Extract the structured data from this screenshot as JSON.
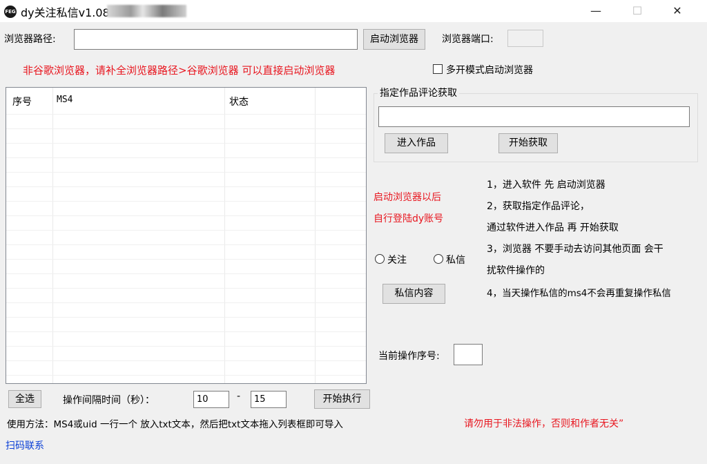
{
  "window": {
    "title": "dy关注私信v1.08-",
    "icon_text": "FEG",
    "minimize": "—",
    "maximize": "☐",
    "close": "✕"
  },
  "browser": {
    "path_label": "浏览器路径:",
    "path_value": "",
    "start_button": "启动浏览器",
    "port_label": "浏览器端口:",
    "port_value": "",
    "hint": "非谷歌浏览器，请补全浏览器路径>谷歌浏览器 可以直接启动浏览器",
    "multi_open_label": "多开模式启动浏览器"
  },
  "list": {
    "columns": [
      "序号",
      "MS4",
      "状态"
    ],
    "rows": []
  },
  "comment_group": {
    "label": "指定作品评论获取",
    "url_value": "",
    "enter_button": "进入作品",
    "start_button": "开始获取"
  },
  "login_hint": {
    "line1": "启动浏览器以后",
    "line2": "自行登陆dy账号"
  },
  "mode": {
    "follow_label": "关注",
    "message_label": "私信"
  },
  "message_content_button": "私信内容",
  "instructions": [
    "1，进入软件 先 启动浏览器",
    "2，获取指定作品评论，",
    "通过软件进入作品 再 开始获取",
    "3，浏览器 不要手动去访问其他页面 会干",
    "扰软件操作的",
    "4，当天操作私信的ms4不会再重复操作私信"
  ],
  "current": {
    "label": "当前操作序号:",
    "value": ""
  },
  "bottom": {
    "select_all": "全选",
    "interval_label": "操作间隔时间（秒）：",
    "interval_min": "10",
    "dash": "-",
    "interval_max": "15",
    "execute": "开始执行",
    "usage": "使用方法：MS4或uid 一行一个 放入txt文本，然后把txt文本拖入列表框即可导入",
    "warning": "请勿用于非法操作，否则和作者无关”",
    "contact": "扫码联系"
  }
}
